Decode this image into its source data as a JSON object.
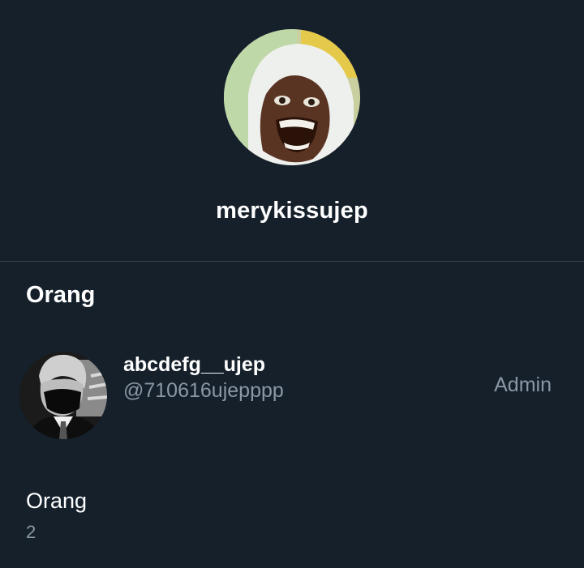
{
  "conversation": {
    "name": "merykissujep",
    "avatar_icon": "group-avatar-photo"
  },
  "people_section": {
    "title": "Orang",
    "members": [
      {
        "display_name": "abcdefg__ujep",
        "handle": "@710616ujepppp",
        "role": "Admin",
        "avatar_icon": "member-avatar-photo"
      }
    ]
  },
  "stats": {
    "label": "Orang",
    "value": "2"
  },
  "colors": {
    "background": "#15202b",
    "divider": "#38444d",
    "secondary_text": "#8b98a5"
  }
}
